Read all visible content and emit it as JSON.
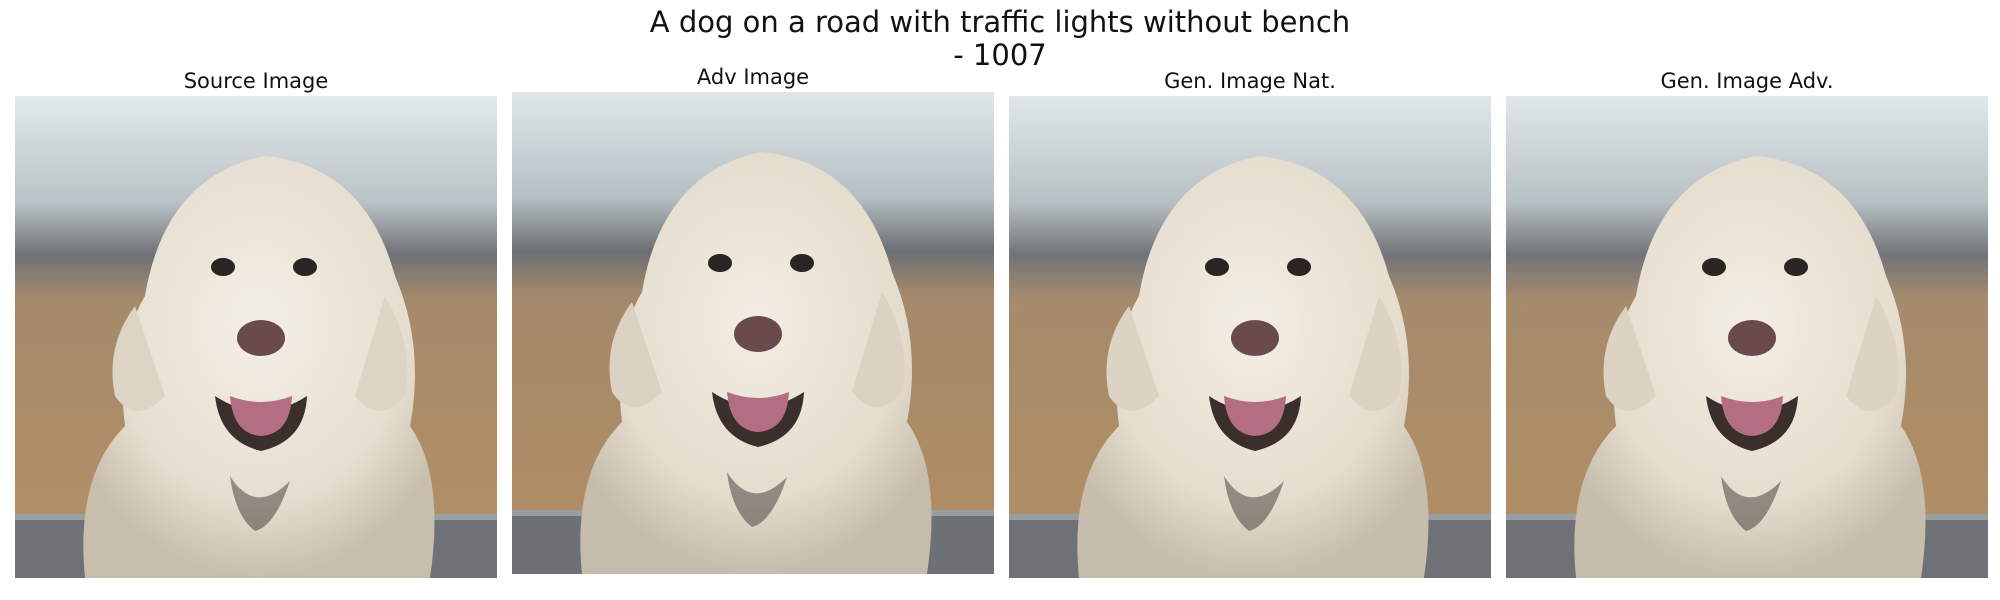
{
  "figure": {
    "title": "A dog on a road with traffic lights without bench\n- 1007",
    "panels": [
      {
        "label": "Source Image",
        "subject": "white curly dog"
      },
      {
        "label": "Adv Image",
        "subject": "white curly dog"
      },
      {
        "label": "Gen. Image Nat.",
        "subject": "white curly dog"
      },
      {
        "label": "Gen. Image Adv.",
        "subject": "white curly dog"
      }
    ]
  },
  "colors": {
    "sky": "#dfe7eb",
    "trees": "#7d8186",
    "field": "#b39067",
    "fur": "#ece5d9",
    "nose": "#6b4a4e",
    "tongue": "#b36e82",
    "fence": "#6f7378"
  }
}
